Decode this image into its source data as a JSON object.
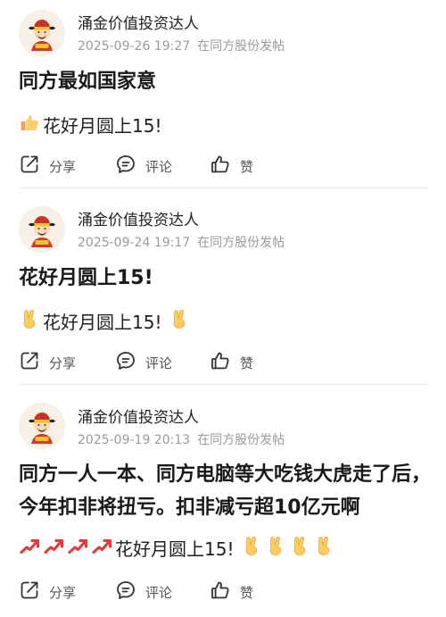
{
  "posts": [
    {
      "author": "涌金价值投资达人",
      "time": "2025-09-26 19:27",
      "location": "在同方股份发帖",
      "title": "同方最如国家意",
      "body": "花好月圆上15!",
      "lead_emojis": [
        "thumbs-up"
      ],
      "trail_emojis": [],
      "actions": {
        "share": "分享",
        "comment": "评论",
        "like": "赞"
      }
    },
    {
      "author": "涌金价值投资达人",
      "time": "2025-09-24 19:17",
      "location": "在同方股份发帖",
      "title": "花好月圆上15!",
      "body": "花好月圆上15!",
      "lead_emojis": [
        "victory-hand"
      ],
      "trail_emojis": [
        "victory-hand"
      ],
      "actions": {
        "share": "分享",
        "comment": "评论",
        "like": "赞"
      }
    },
    {
      "author": "涌金价值投资达人",
      "time": "2025-09-19 20:13",
      "location": "在同方股份发帖",
      "title": "同方一人一本、同方电脑等大吃钱大虎走了后，今年扣非将扭亏。扣非减亏超10亿元啊",
      "body": "花好月圆上15!",
      "lead_emojis": [
        "chart-increasing",
        "chart-increasing",
        "chart-increasing",
        "chart-increasing"
      ],
      "trail_emojis": [
        "victory-hand",
        "victory-hand",
        "victory-hand",
        "victory-hand"
      ],
      "actions": {
        "share": "分享",
        "comment": "评论",
        "like": "赞"
      }
    }
  ],
  "icons": {
    "avatar": "god-of-wealth-avatar-icon",
    "share": "share-icon",
    "comment": "comment-icon",
    "like": "thumbs-up-icon"
  },
  "colors": {
    "meta_text": "#9a9a9a",
    "divider": "#ececec"
  }
}
